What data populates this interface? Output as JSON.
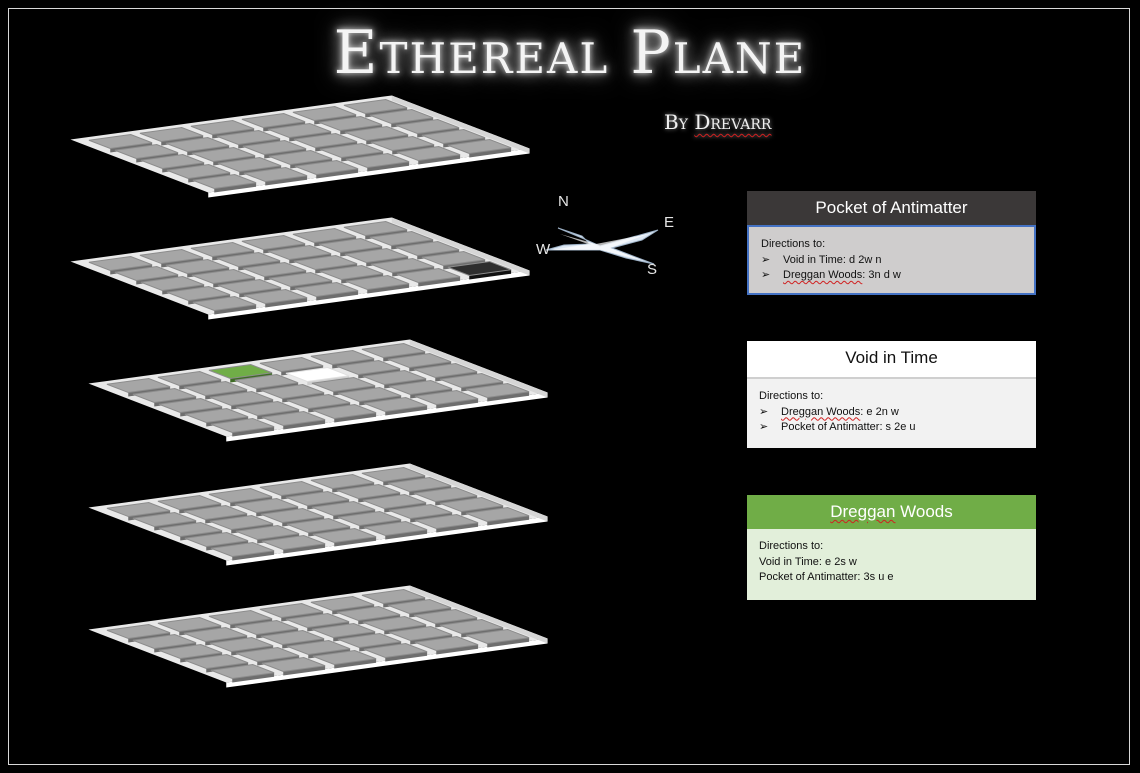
{
  "title": "Ethereal Plane",
  "byline": {
    "prefix": "By",
    "author": "Drevarr"
  },
  "compass": {
    "n": "N",
    "e": "E",
    "s": "S",
    "w": "W"
  },
  "colors": {
    "tile": "#a6a6a6",
    "tile_dark": "#2e2e2e",
    "tile_green": "#70ad47",
    "tile_white": "#ffffff",
    "slab": "#ffffff",
    "background": "#000000"
  },
  "floors": [
    {
      "name": "floor-1",
      "rows": 5,
      "cols": 6,
      "highlights": []
    },
    {
      "name": "floor-2",
      "rows": 5,
      "cols": 6,
      "highlights": [
        {
          "row": 4,
          "col": 5,
          "kind": "dark"
        }
      ]
    },
    {
      "name": "floor-3",
      "rows": 5,
      "cols": 6,
      "highlights": [
        {
          "row": 0,
          "col": 2,
          "kind": "green"
        },
        {
          "row": 1,
          "col": 3,
          "kind": "white"
        }
      ]
    },
    {
      "name": "floor-4",
      "rows": 5,
      "cols": 6,
      "highlights": []
    },
    {
      "name": "floor-5",
      "rows": 5,
      "cols": 6,
      "highlights": []
    }
  ],
  "cards": {
    "pocket": {
      "title": "Pocket of Antimatter",
      "subtitle": "Directions to:",
      "items": [
        {
          "place": "Void in Time",
          "route": ": d 2w n"
        },
        {
          "place": "Dreggan Woods",
          "route": ": 3n d w"
        }
      ]
    },
    "void": {
      "title": "Void in Time",
      "subtitle": "Directions to:",
      "items": [
        {
          "place": "Dreggan Woods",
          "route": ": e 2n w"
        },
        {
          "place": "Pocket of Antimatter",
          "route": ": s 2e u"
        }
      ]
    },
    "dreggan": {
      "title_word1": "Dreggan",
      "title_word2": " Woods",
      "subtitle": "Directions to:",
      "line1": "Void in Time: e 2s w",
      "line2": "Pocket of Antimatter: 3s u e"
    }
  }
}
